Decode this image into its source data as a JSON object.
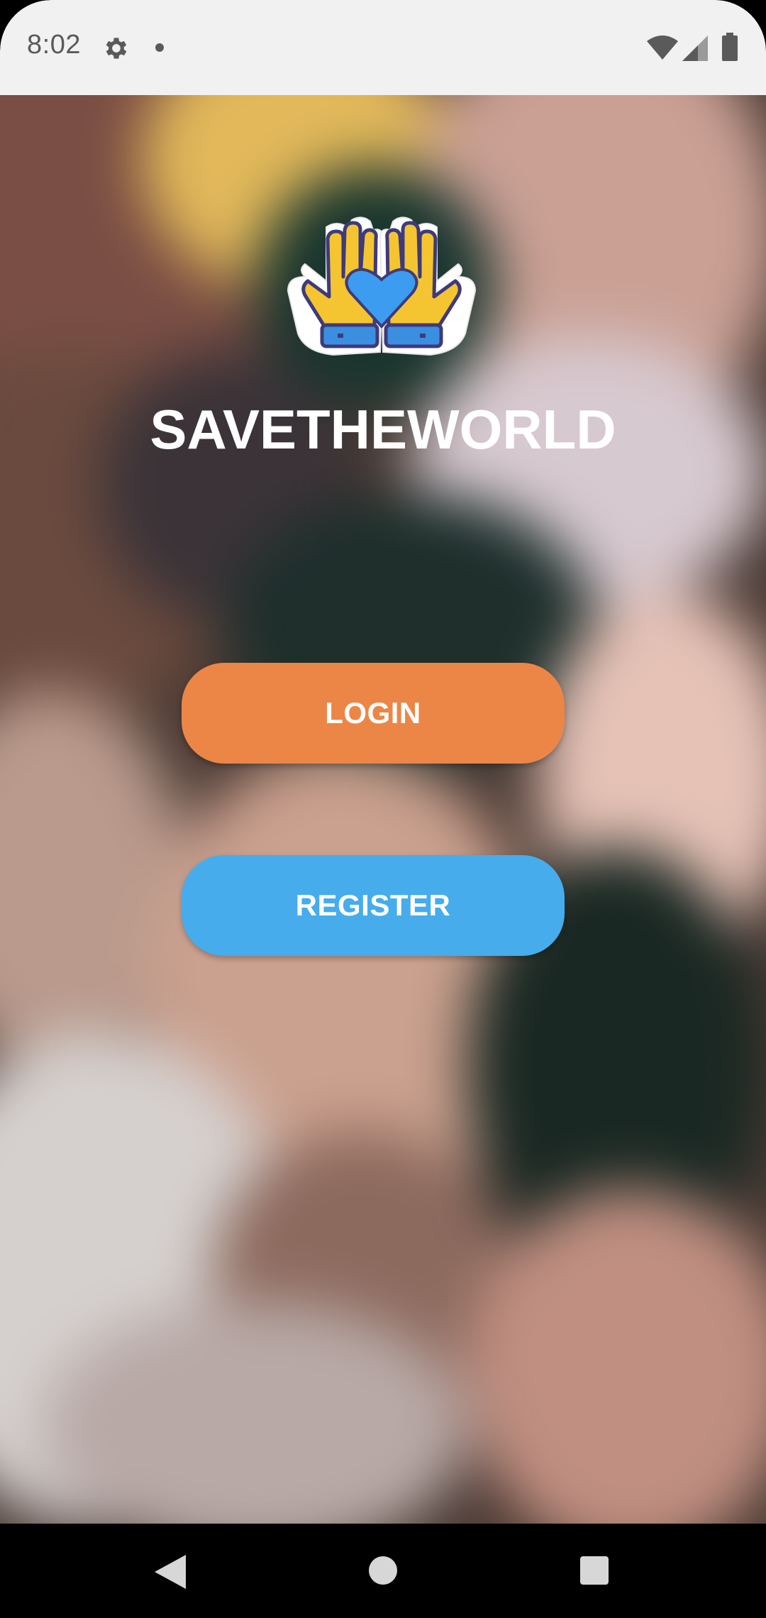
{
  "status_bar": {
    "time": "8:02",
    "icons": [
      "gear-icon",
      "notification-dot-icon",
      "wifi-icon",
      "signal-icon",
      "battery-icon"
    ]
  },
  "app": {
    "title": "SAVETHEWORLD",
    "logo_icon": "hands-heart-icon"
  },
  "buttons": {
    "login_label": "LOGIN",
    "register_label": "REGISTER"
  },
  "colors": {
    "login": "#ec8646",
    "register": "#46acec",
    "status_bar_bg": "#f1f1f1"
  },
  "nav_bar": {
    "icons": [
      "back-icon",
      "home-icon",
      "recents-icon"
    ]
  }
}
